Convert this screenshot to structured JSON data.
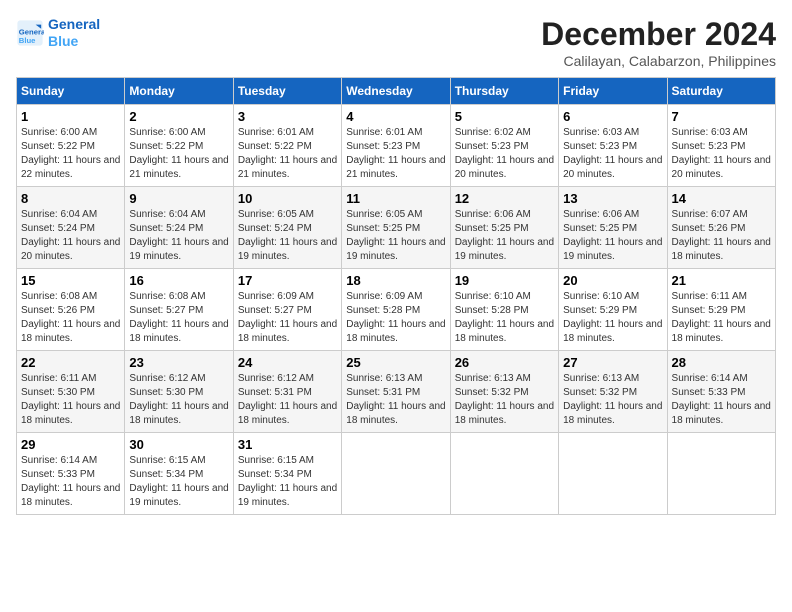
{
  "logo": {
    "line1": "General",
    "line2": "Blue"
  },
  "title": "December 2024",
  "subtitle": "Calilayan, Calabarzon, Philippines",
  "days_header": [
    "Sunday",
    "Monday",
    "Tuesday",
    "Wednesday",
    "Thursday",
    "Friday",
    "Saturday"
  ],
  "weeks": [
    [
      {
        "day": "1",
        "sunrise": "6:00 AM",
        "sunset": "5:22 PM",
        "daylight": "11 hours and 22 minutes."
      },
      {
        "day": "2",
        "sunrise": "6:00 AM",
        "sunset": "5:22 PM",
        "daylight": "11 hours and 21 minutes."
      },
      {
        "day": "3",
        "sunrise": "6:01 AM",
        "sunset": "5:22 PM",
        "daylight": "11 hours and 21 minutes."
      },
      {
        "day": "4",
        "sunrise": "6:01 AM",
        "sunset": "5:23 PM",
        "daylight": "11 hours and 21 minutes."
      },
      {
        "day": "5",
        "sunrise": "6:02 AM",
        "sunset": "5:23 PM",
        "daylight": "11 hours and 20 minutes."
      },
      {
        "day": "6",
        "sunrise": "6:03 AM",
        "sunset": "5:23 PM",
        "daylight": "11 hours and 20 minutes."
      },
      {
        "day": "7",
        "sunrise": "6:03 AM",
        "sunset": "5:23 PM",
        "daylight": "11 hours and 20 minutes."
      }
    ],
    [
      {
        "day": "8",
        "sunrise": "6:04 AM",
        "sunset": "5:24 PM",
        "daylight": "11 hours and 20 minutes."
      },
      {
        "day": "9",
        "sunrise": "6:04 AM",
        "sunset": "5:24 PM",
        "daylight": "11 hours and 19 minutes."
      },
      {
        "day": "10",
        "sunrise": "6:05 AM",
        "sunset": "5:24 PM",
        "daylight": "11 hours and 19 minutes."
      },
      {
        "day": "11",
        "sunrise": "6:05 AM",
        "sunset": "5:25 PM",
        "daylight": "11 hours and 19 minutes."
      },
      {
        "day": "12",
        "sunrise": "6:06 AM",
        "sunset": "5:25 PM",
        "daylight": "11 hours and 19 minutes."
      },
      {
        "day": "13",
        "sunrise": "6:06 AM",
        "sunset": "5:25 PM",
        "daylight": "11 hours and 19 minutes."
      },
      {
        "day": "14",
        "sunrise": "6:07 AM",
        "sunset": "5:26 PM",
        "daylight": "11 hours and 18 minutes."
      }
    ],
    [
      {
        "day": "15",
        "sunrise": "6:08 AM",
        "sunset": "5:26 PM",
        "daylight": "11 hours and 18 minutes."
      },
      {
        "day": "16",
        "sunrise": "6:08 AM",
        "sunset": "5:27 PM",
        "daylight": "11 hours and 18 minutes."
      },
      {
        "day": "17",
        "sunrise": "6:09 AM",
        "sunset": "5:27 PM",
        "daylight": "11 hours and 18 minutes."
      },
      {
        "day": "18",
        "sunrise": "6:09 AM",
        "sunset": "5:28 PM",
        "daylight": "11 hours and 18 minutes."
      },
      {
        "day": "19",
        "sunrise": "6:10 AM",
        "sunset": "5:28 PM",
        "daylight": "11 hours and 18 minutes."
      },
      {
        "day": "20",
        "sunrise": "6:10 AM",
        "sunset": "5:29 PM",
        "daylight": "11 hours and 18 minutes."
      },
      {
        "day": "21",
        "sunrise": "6:11 AM",
        "sunset": "5:29 PM",
        "daylight": "11 hours and 18 minutes."
      }
    ],
    [
      {
        "day": "22",
        "sunrise": "6:11 AM",
        "sunset": "5:30 PM",
        "daylight": "11 hours and 18 minutes."
      },
      {
        "day": "23",
        "sunrise": "6:12 AM",
        "sunset": "5:30 PM",
        "daylight": "11 hours and 18 minutes."
      },
      {
        "day": "24",
        "sunrise": "6:12 AM",
        "sunset": "5:31 PM",
        "daylight": "11 hours and 18 minutes."
      },
      {
        "day": "25",
        "sunrise": "6:13 AM",
        "sunset": "5:31 PM",
        "daylight": "11 hours and 18 minutes."
      },
      {
        "day": "26",
        "sunrise": "6:13 AM",
        "sunset": "5:32 PM",
        "daylight": "11 hours and 18 minutes."
      },
      {
        "day": "27",
        "sunrise": "6:13 AM",
        "sunset": "5:32 PM",
        "daylight": "11 hours and 18 minutes."
      },
      {
        "day": "28",
        "sunrise": "6:14 AM",
        "sunset": "5:33 PM",
        "daylight": "11 hours and 18 minutes."
      }
    ],
    [
      {
        "day": "29",
        "sunrise": "6:14 AM",
        "sunset": "5:33 PM",
        "daylight": "11 hours and 18 minutes."
      },
      {
        "day": "30",
        "sunrise": "6:15 AM",
        "sunset": "5:34 PM",
        "daylight": "11 hours and 19 minutes."
      },
      {
        "day": "31",
        "sunrise": "6:15 AM",
        "sunset": "5:34 PM",
        "daylight": "11 hours and 19 minutes."
      },
      null,
      null,
      null,
      null
    ]
  ]
}
